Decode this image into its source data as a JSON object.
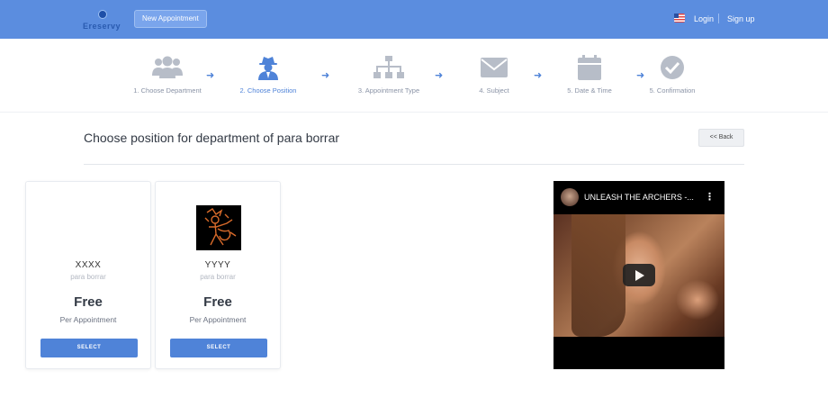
{
  "header": {
    "logo_text": "Ereservy",
    "new_appointment_label": "New Appointment",
    "login_label": "Login",
    "signup_label": "Sign up"
  },
  "steps": [
    {
      "label": "1. Choose Department",
      "icon": "users-icon",
      "active": false
    },
    {
      "label": "2. Choose Position",
      "icon": "user-secret-icon",
      "active": true
    },
    {
      "label": "3. Appointment Type",
      "icon": "sitemap-icon",
      "active": false
    },
    {
      "label": "4. Subject",
      "icon": "envelope-icon",
      "active": false
    },
    {
      "label": "5. Date & Time",
      "icon": "calendar-icon",
      "active": false
    },
    {
      "label": "5. Confirmation",
      "icon": "check-circle-icon",
      "active": false
    }
  ],
  "page": {
    "title": "Choose position for department of para borrar",
    "back_label": "<< Back"
  },
  "positions": [
    {
      "name": "XXXX",
      "department": "para borrar",
      "price": "Free",
      "per": "Per Appointment",
      "select_label": "SELECT",
      "has_image": false
    },
    {
      "name": "YYYY",
      "department": "para borrar",
      "price": "Free",
      "per": "Per Appointment",
      "select_label": "SELECT",
      "has_image": true
    }
  ],
  "video": {
    "title": "UNLEASH THE ARCHERS -..."
  },
  "colors": {
    "header": "#5b8ddf",
    "accent": "#4f83d8",
    "step_icon": "#b7bdc8"
  }
}
